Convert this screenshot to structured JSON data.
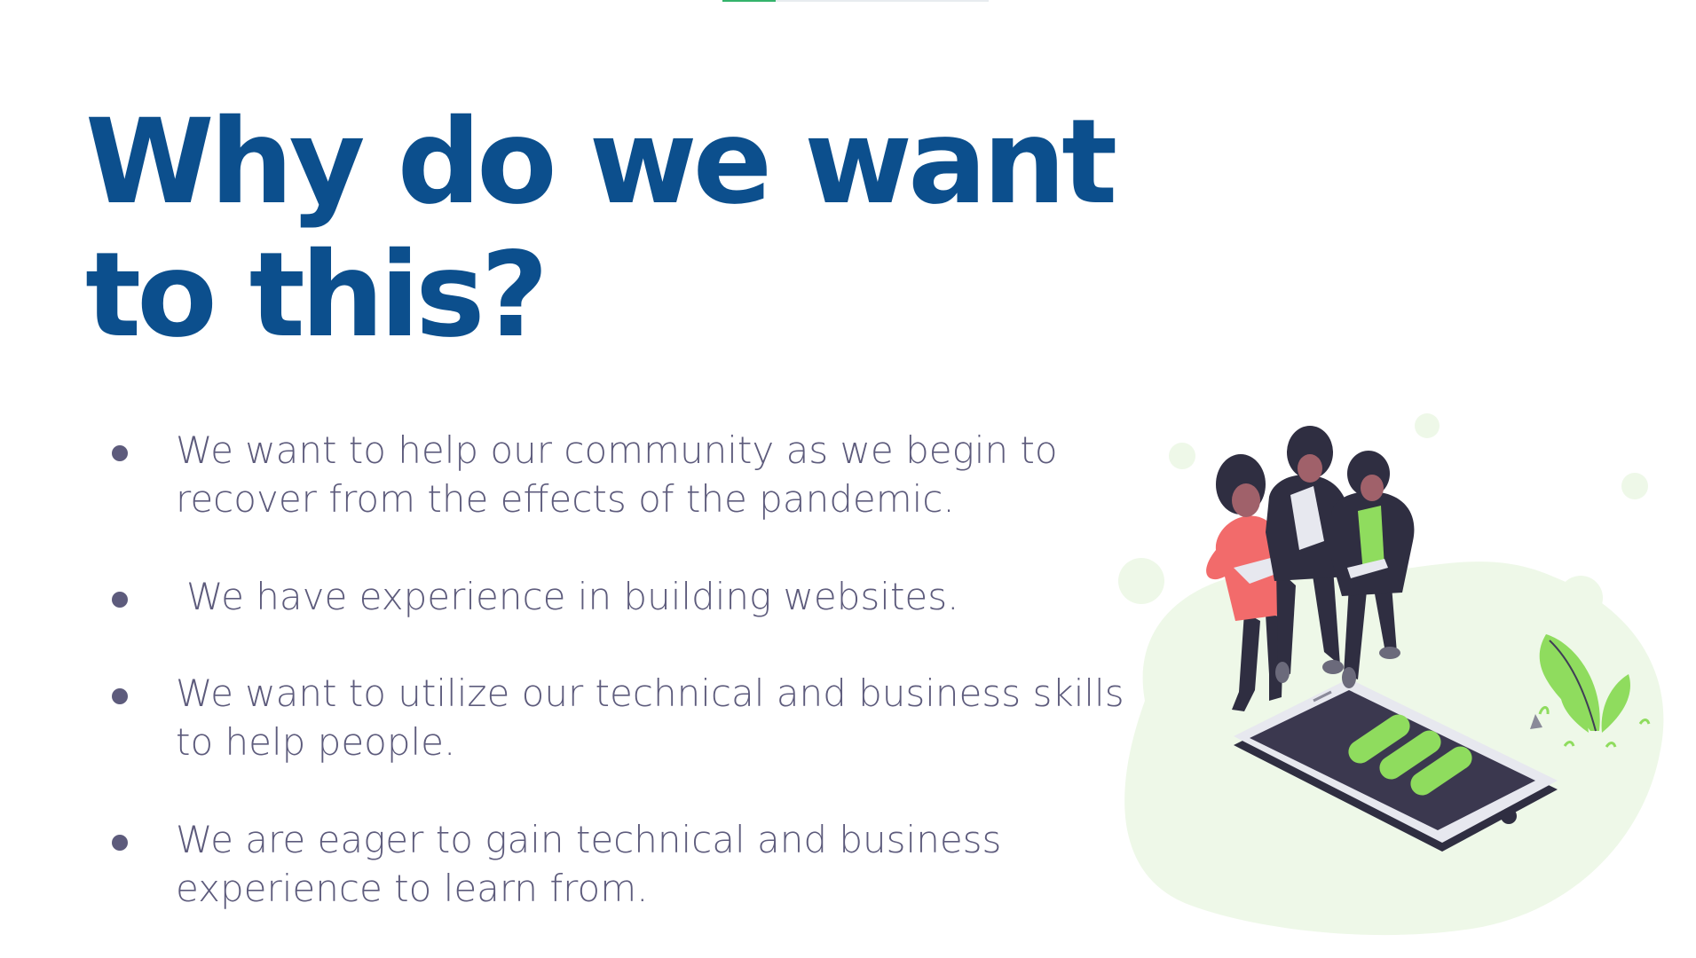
{
  "slide": {
    "title": "Why do we want to this?",
    "bullets": [
      {
        "text": "We want to help our community as we begin to recover from the effects of the pandemic."
      },
      {
        "text": "We have experience in building websites."
      },
      {
        "text": "We want to utilize our technical and business skills to help people."
      },
      {
        "text": "We are eager to gain technical and business experience to learn from."
      }
    ]
  },
  "illustration": {
    "subject": "three people looking down at a large smartphone",
    "icon": "people-with-phone-illustration"
  },
  "colors": {
    "title": "#0c4f8d",
    "body_text": "#5d5b7c",
    "accent_green": "#8fdc5e",
    "background_blob": "#eef8e8",
    "phone_screen": "#3b384f",
    "jacket": "#2f2e41",
    "shirt_red": "#f26b6b"
  }
}
